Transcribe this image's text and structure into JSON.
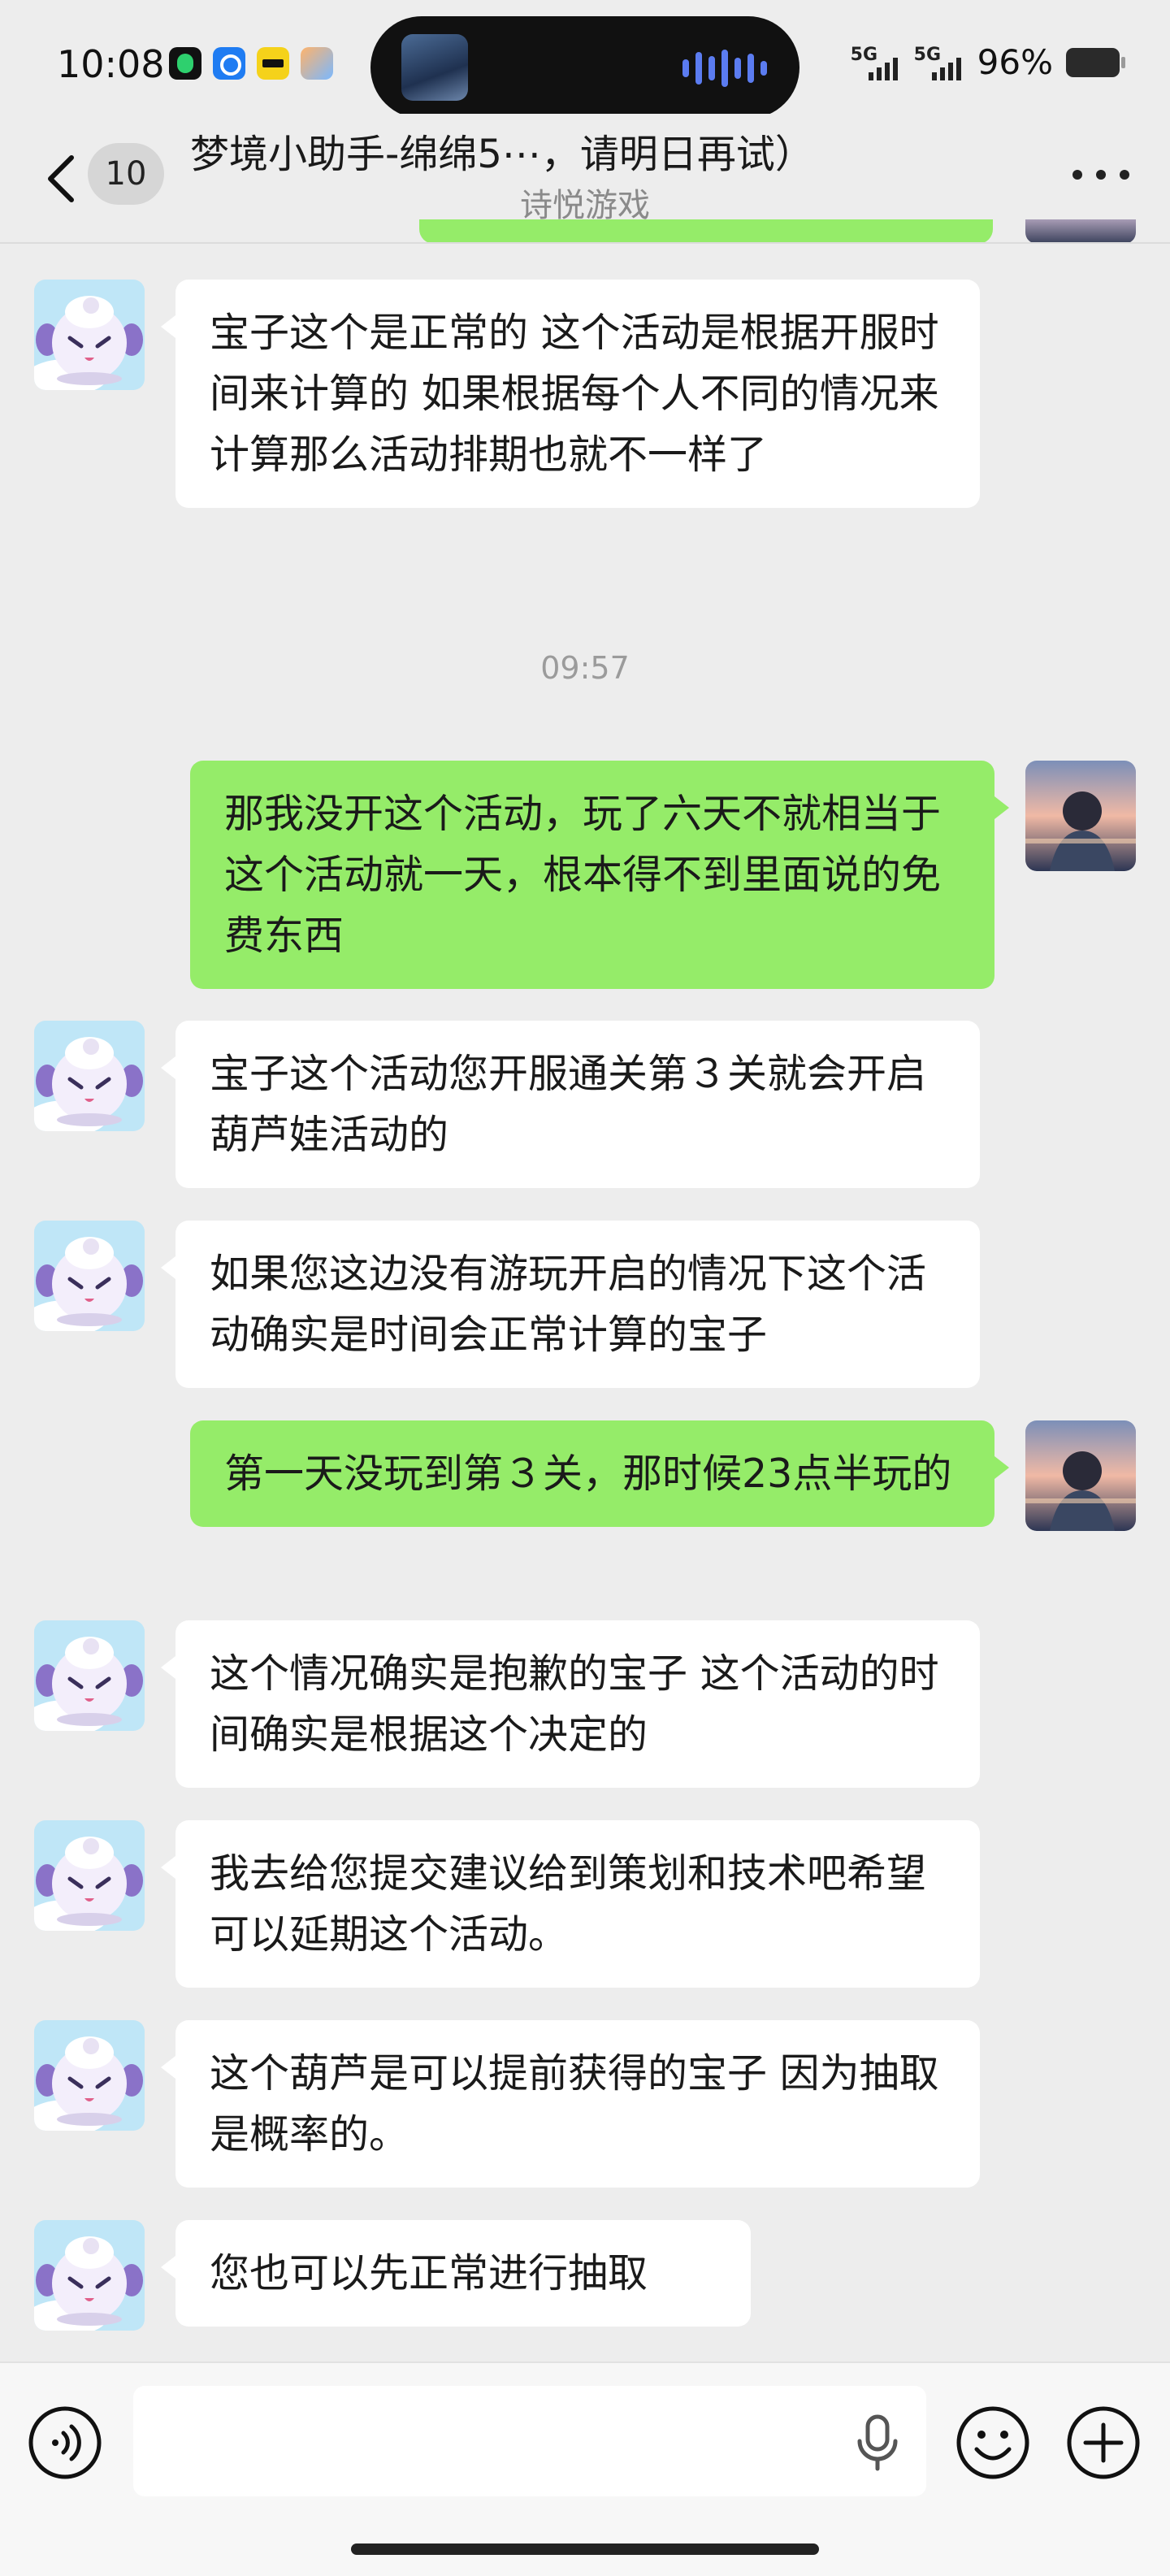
{
  "status_bar": {
    "time": "10:08",
    "network_1": "5G",
    "network_2": "5G",
    "battery_percent": "96%",
    "app_icons": [
      "qq-music-icon",
      "browser-icon",
      "wallet-icon",
      "gallery-icon"
    ]
  },
  "header": {
    "back_icon": "chevron-left-icon",
    "unread_count": "10",
    "title": "梦境小助手-绵绵5⋯，请明日再试）",
    "subtitle": "诗悦游戏",
    "more_icon": "more-dots-icon"
  },
  "messages": [
    {
      "side": "in",
      "text": "宝子这个是正常的 这个活动是根据开服时间来计算的 如果根据每个人不同的情况来计算那么活动排期也就不一样了"
    },
    {
      "side": "time",
      "text": "09:57"
    },
    {
      "side": "out",
      "text": "那我没开这个活动，玩了六天不就相当于这个活动就一天，根本得不到里面说的免费东西"
    },
    {
      "side": "in",
      "text": "宝子这个活动您开服通关第３关就会开启葫芦娃活动的"
    },
    {
      "side": "in",
      "text": "如果您这边没有游玩开启的情况下这个活动确实是时间会正常计算的宝子"
    },
    {
      "side": "out",
      "text": "第一天没玩到第３关，那时候23点半玩的"
    },
    {
      "side": "in",
      "text": "这个情况确实是抱歉的宝子 这个活动的时间确实是根据这个决定的"
    },
    {
      "side": "in",
      "text": "我去给您提交建议给到策划和技术吧希望可以延期这个活动。"
    },
    {
      "side": "in",
      "text": "这个葫芦是可以提前获得的宝子 因为抽取是概率的。"
    },
    {
      "side": "in",
      "text": "您也可以先正常进行抽取"
    }
  ],
  "input_bar": {
    "voice_icon": "voice-mode-icon",
    "input_value": "",
    "mic_icon": "microphone-icon",
    "emoji_icon": "emoji-icon",
    "plus_icon": "plus-circle-icon"
  },
  "colors": {
    "background": "#ededed",
    "incoming_bubble": "#ffffff",
    "outgoing_bubble": "#95ec69"
  }
}
